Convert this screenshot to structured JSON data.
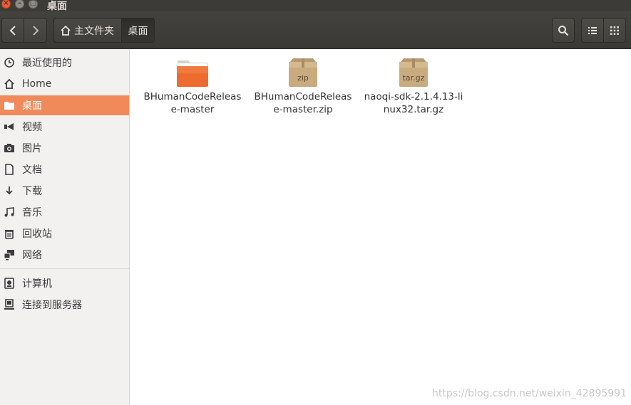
{
  "window": {
    "title": "桌面"
  },
  "header": {
    "breadcrumb_home_label": "主文件夹",
    "breadcrumb_current_label": "桌面"
  },
  "sidebar": {
    "items": [
      {
        "label": "最近使用的",
        "icon": "clock-icon"
      },
      {
        "label": "Home",
        "icon": "home-icon"
      },
      {
        "label": "桌面",
        "icon": "folder-icon"
      },
      {
        "label": "视频",
        "icon": "video-icon"
      },
      {
        "label": "图片",
        "icon": "camera-icon"
      },
      {
        "label": "文档",
        "icon": "document-icon"
      },
      {
        "label": "下载",
        "icon": "download-icon"
      },
      {
        "label": "音乐",
        "icon": "music-icon"
      },
      {
        "label": "回收站",
        "icon": "trash-icon"
      },
      {
        "label": "网络",
        "icon": "network-icon"
      },
      {
        "label": "计算机",
        "icon": "computer-icon"
      },
      {
        "label": "连接到服务器",
        "icon": "server-icon"
      }
    ],
    "active_index": 2
  },
  "files": [
    {
      "name": "BHumanCodeRelease-master",
      "type": "folder",
      "icon": "folder-icon"
    },
    {
      "name": "BHumanCodeRelease-master.zip",
      "type": "zip",
      "icon": "archive-icon",
      "badge": "zip"
    },
    {
      "name": "naoqi-sdk-2.1.4.13-linux32.tar.gz",
      "type": "tar.gz",
      "icon": "archive-icon",
      "badge": "tar.gz"
    }
  ],
  "watermark": "https://blog.csdn.net/weixin_42895991",
  "colors": {
    "accent": "#f18a5a",
    "titlebar": "#3c3b37",
    "sidebar_bg": "#f2f1f0"
  }
}
